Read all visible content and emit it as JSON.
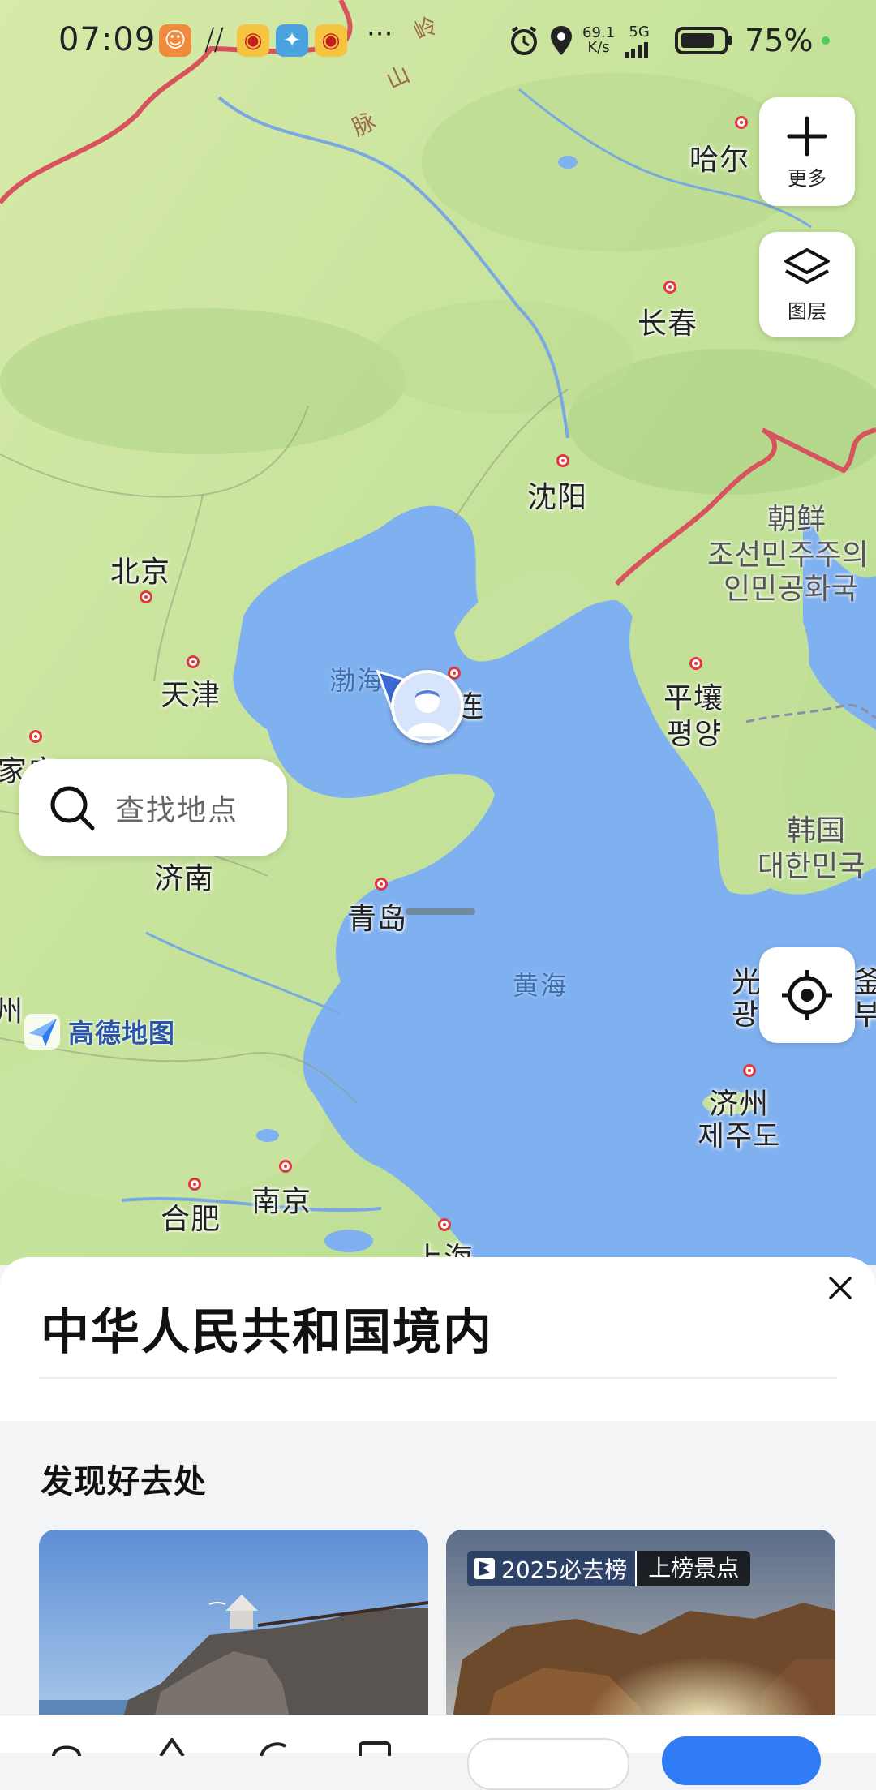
{
  "status_bar": {
    "time": "07:09",
    "more": "···",
    "speed_value": "69.1",
    "speed_unit": "K/s",
    "network": "5G",
    "battery": "75%"
  },
  "map": {
    "controls": {
      "more_label": "更多",
      "layers_label": "图层"
    },
    "search_placeholder": "查找地点",
    "logo_text": "高德地图",
    "cities": [
      {
        "name": "哈尔"
      },
      {
        "name": "长春"
      },
      {
        "name": "沈阳"
      },
      {
        "name": "北京"
      },
      {
        "name": "天津"
      },
      {
        "name": "石家庄"
      },
      {
        "name": "连"
      },
      {
        "name": "平壤"
      },
      {
        "name": "평양"
      },
      {
        "name": "济南"
      },
      {
        "name": "青岛"
      },
      {
        "name": "光"
      },
      {
        "name": "광"
      },
      {
        "name": "济州"
      },
      {
        "name": "제주도"
      },
      {
        "name": "南京"
      },
      {
        "name": "合肥"
      },
      {
        "name": "上海"
      }
    ],
    "seas": [
      {
        "name": "渤海"
      },
      {
        "name": "黄海"
      }
    ],
    "mountains": [
      {
        "name": "岭"
      },
      {
        "name": "山"
      },
      {
        "name": "脉"
      }
    ],
    "countries": [
      {
        "lines": [
          "朝鲜",
          "조선민주주의",
          "인민공화국"
        ]
      },
      {
        "lines": [
          "韩国",
          "대한민국"
        ]
      }
    ],
    "edge_labels": [
      "州",
      "釜",
      "부"
    ]
  },
  "sheet": {
    "region_title": "中华人民共和国境内",
    "discover_title": "发现好去处",
    "cards": [
      {
        "badge_left": "",
        "badge_right": ""
      },
      {
        "badge_left": "2025必去榜",
        "badge_right": "上榜景点"
      }
    ]
  },
  "colors": {
    "land": "#cfe6a4",
    "sea": "#7fb0ef",
    "border_red": "#d9535f",
    "accent_blue": "#2f7cf6"
  }
}
